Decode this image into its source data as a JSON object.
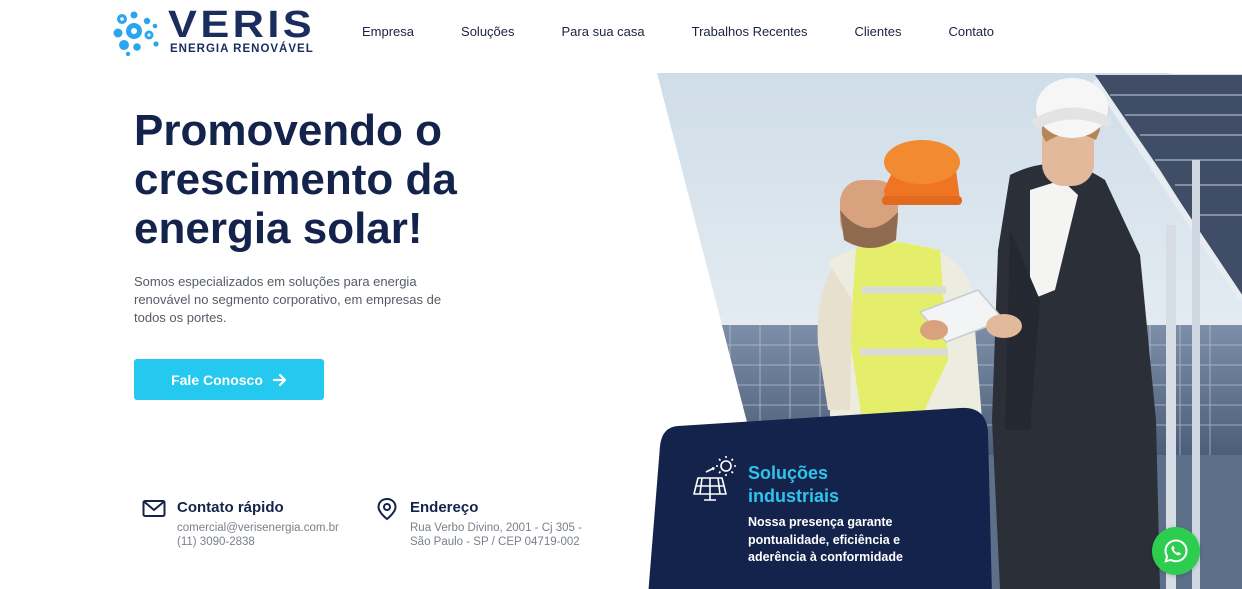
{
  "brand": {
    "name": "VERIS",
    "tagline": "ENERGIA RENOVÁVEL",
    "primary_color": "#1b2d5e",
    "accent_color": "#25c8ee"
  },
  "nav": {
    "items": [
      {
        "label": "Empresa"
      },
      {
        "label": "Soluções"
      },
      {
        "label": "Para sua casa"
      },
      {
        "label": "Trabalhos Recentes"
      },
      {
        "label": "Clientes"
      },
      {
        "label": "Contato"
      }
    ]
  },
  "hero": {
    "title_lines": [
      "Promovendo o",
      "crescimento da",
      "energia solar!"
    ],
    "subtitle": "Somos especializados em soluções para energia renovável no segmento corporativo, em empresas de todos os portes.",
    "cta_label": "Fale Conosco",
    "cta_icon": "arrow-right-icon"
  },
  "contact": {
    "quick": {
      "title": "Contato rápido",
      "icon": "mail-icon",
      "email": "comercial@verisenergia.com.br",
      "phone": "(11) 3090-2838"
    },
    "address": {
      "title": "Endereço",
      "icon": "map-pin-icon",
      "line1": "Rua Verbo Divino, 2001 - Cj 305 -",
      "line2": "São Paulo - SP / CEP 04719-002"
    }
  },
  "card": {
    "title": "Soluções industriais",
    "text": "Nossa presença garante pontualidade, eficiência e aderência à conformidade",
    "icon": "solar-panel-icon",
    "background": "#14234b"
  },
  "whatsapp": {
    "icon": "whatsapp-icon",
    "color": "#2ecc4f"
  }
}
